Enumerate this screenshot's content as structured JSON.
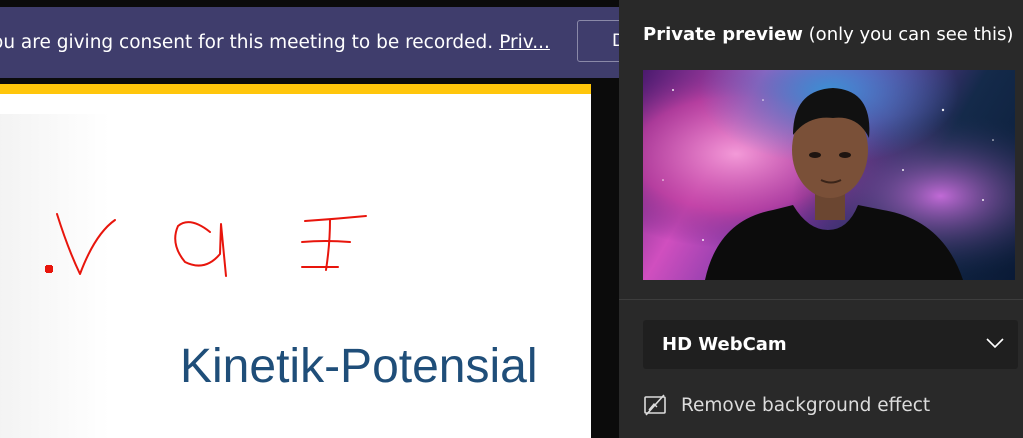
{
  "banner": {
    "consent_text": "ou are giving consent for this meeting to be recorded.",
    "privacy_link": "Priv...",
    "button_label": "D"
  },
  "slide": {
    "title": "Kinetik-Potensial",
    "accent_color": "#ffc60b",
    "ink_color": "#e8150c"
  },
  "preview": {
    "heading_bold": "Private preview",
    "heading_rest": "(only you can see this)"
  },
  "camera": {
    "selected": "HD WebCam"
  },
  "background_effect": {
    "label": "Remove background effect",
    "icon": "no-background-icon"
  }
}
